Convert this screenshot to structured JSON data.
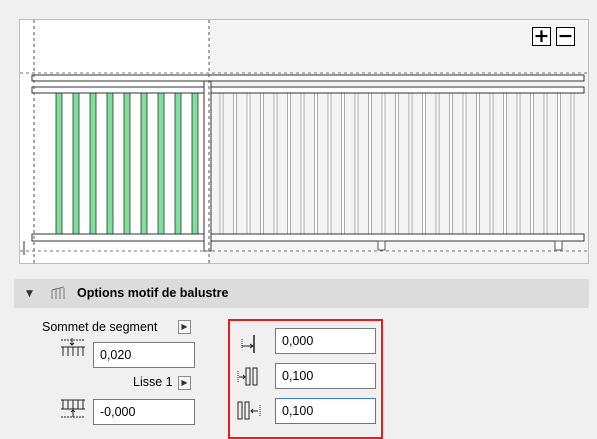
{
  "preview": {
    "zoom_in_label": "+",
    "zoom_out_label": "−",
    "highlight_color": "#7ee09a"
  },
  "section": {
    "title": "Options motif de balustre"
  },
  "segment_top": {
    "label": "Sommet de segment",
    "value": "0,020"
  },
  "rail": {
    "label": "Lisse 1",
    "value": "-0,000"
  },
  "offsets": {
    "offset_value": "0,000",
    "left_spacing_value": "0,100",
    "right_spacing_value": "0,100"
  },
  "colors": {
    "highlight_frame": "#e02020",
    "focus_border": "#3c7fd0"
  }
}
